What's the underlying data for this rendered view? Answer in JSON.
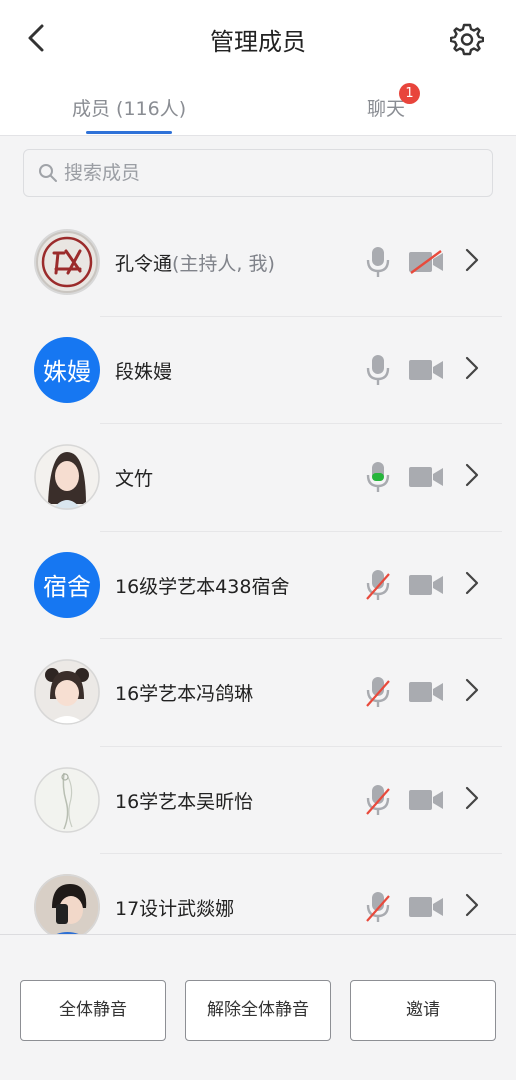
{
  "header": {
    "title": "管理成员"
  },
  "tabs": [
    {
      "label": "成员 (116人)",
      "active": true
    },
    {
      "label": "聊天",
      "badge": "1"
    }
  ],
  "search": {
    "placeholder": "搜索成员",
    "value": ""
  },
  "members": [
    {
      "name": "孔令通",
      "suffix": "(主持人, 我)",
      "avatar": "seal-logo",
      "mic": "on",
      "video": "off"
    },
    {
      "name": "段姝嫚",
      "avatar_text": "姝嫚",
      "mic": "on",
      "video": "on"
    },
    {
      "name": "文竹",
      "avatar": "photo-woman",
      "mic": "speaking",
      "video": "on"
    },
    {
      "name": "16级学艺本438宿舍",
      "avatar_text": "宿舍",
      "mic": "muted",
      "video": "on"
    },
    {
      "name": "16学艺本冯鸽琳",
      "avatar": "photo-girl",
      "mic": "muted",
      "video": "on"
    },
    {
      "name": "16学艺本吴昕怡",
      "avatar": "photo-sketch",
      "mic": "muted",
      "video": "on"
    },
    {
      "name": "17设计武燚娜",
      "avatar": "photo-person",
      "mic": "muted",
      "video": "on"
    }
  ],
  "footer": {
    "mute_all": "全体静音",
    "unmute_all": "解除全体静音",
    "invite": "邀请"
  },
  "colors": {
    "accent": "#2f72d8",
    "avatar_bg": "#1677f2",
    "muted": "#e84a3c",
    "speaking": "#27b53c",
    "badge": "#e8453c"
  }
}
